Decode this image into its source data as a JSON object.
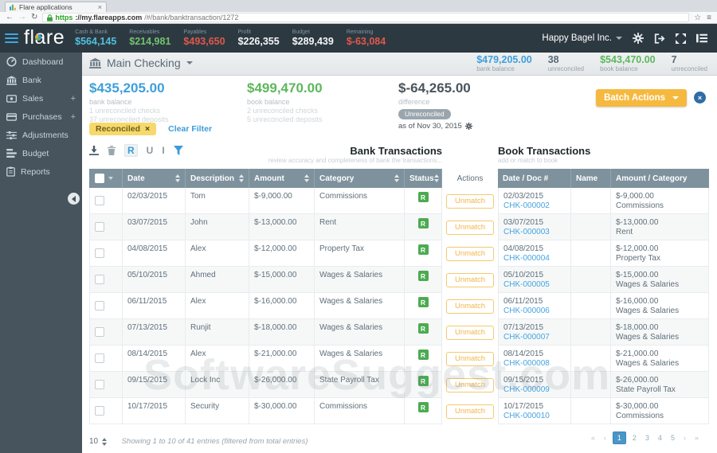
{
  "glyphs": {
    "close": "×",
    "plus": "+"
  },
  "browser": {
    "tab_title": "Flare applications",
    "nav": {
      "back": "←",
      "forward": "→",
      "refresh": "↻"
    },
    "url": {
      "protocol": "https",
      "host": "://my.flareapps.com",
      "path": "/#/bank/banktransaction/1272"
    },
    "actions": {
      "star": "☆",
      "menu": "≡"
    }
  },
  "topnav": {
    "logo": "flare",
    "stats": [
      {
        "label": "Cash & Bank",
        "value": "$564,145",
        "color": "#4fc0dd"
      },
      {
        "label": "Receivables",
        "value": "$214,981",
        "color": "#72c46d"
      },
      {
        "label": "Payables",
        "value": "$493,650",
        "color": "#e2574c"
      },
      {
        "label": "Profit",
        "value": "$226,355",
        "color": "#f4f6f7"
      },
      {
        "label": "Budget",
        "value": "$289,439",
        "color": "#f4f6f7"
      },
      {
        "label": "Remaining",
        "value": "$-63,084",
        "color": "#e2574c"
      }
    ],
    "company": "Happy Bagel Inc."
  },
  "sidebar": {
    "items": [
      {
        "label": "Dashboard",
        "expandable": false
      },
      {
        "label": "Bank",
        "expandable": false
      },
      {
        "label": "Sales",
        "expandable": true
      },
      {
        "label": "Purchases",
        "expandable": true
      },
      {
        "label": "Adjustments",
        "expandable": false
      },
      {
        "label": "Budget",
        "expandable": false
      },
      {
        "label": "Reports",
        "expandable": false
      }
    ]
  },
  "account_bar": {
    "account_name": "Main Checking",
    "bank_balance": {
      "value": "$479,205.00",
      "label": "bank balance"
    },
    "bank_unreconciled": {
      "value": "38",
      "label": "unreconciled"
    },
    "book_balance": {
      "value": "$543,470.00",
      "label": "book balance"
    },
    "book_unreconciled": {
      "value": "7",
      "label": "unreconciled"
    }
  },
  "summary": {
    "bank": {
      "value": "$435,205.00",
      "label": "bank balance",
      "line1": "1 unreconciled checks",
      "line2": "37 unreconciled deposits"
    },
    "book": {
      "value": "$499,470.00",
      "label": "book balance",
      "line1": "2 unreconciled checks",
      "line2": "5 unreconciled deposits"
    },
    "difference": {
      "value": "$-64,265.00",
      "label": "difference",
      "badge": "Unreconciled",
      "as_of": "as of Nov 30, 2015"
    },
    "batch_actions_label": "Batch Actions"
  },
  "filters": {
    "chip": "Reconciled",
    "clear_label": "Clear Filter"
  },
  "toolbar": {
    "r": "R",
    "u": "U",
    "i": "I"
  },
  "bank_table": {
    "title": "Bank Transactions",
    "subtitle": "review accuracy and completeness of bank the transactions...",
    "columns": [
      "Date",
      "Description",
      "Amount",
      "Category",
      "Status"
    ],
    "rows": [
      {
        "date": "02/03/2015",
        "description": "Tom",
        "amount": "$-9,000.00",
        "category": "Commissions",
        "status": "R"
      },
      {
        "date": "03/07/2015",
        "description": "John",
        "amount": "$-13,000.00",
        "category": "Rent",
        "status": "R"
      },
      {
        "date": "04/08/2015",
        "description": "Alex",
        "amount": "$-12,000.00",
        "category": "Property Tax",
        "status": "R"
      },
      {
        "date": "05/10/2015",
        "description": "Ahmed",
        "amount": "$-15,000.00",
        "category": "Wages & Salaries",
        "status": "R"
      },
      {
        "date": "06/11/2015",
        "description": "Alex",
        "amount": "$-16,000.00",
        "category": "Wages & Salaries",
        "status": "R"
      },
      {
        "date": "07/13/2015",
        "description": "Runjit",
        "amount": "$-18,000.00",
        "category": "Wages & Salaries",
        "status": "R"
      },
      {
        "date": "08/14/2015",
        "description": "Alex",
        "amount": "$-21,000.00",
        "category": "Wages & Salaries",
        "status": "R"
      },
      {
        "date": "09/15/2015",
        "description": "Lock Inc",
        "amount": "$-26,000.00",
        "category": "State Payroll Tax",
        "status": "R"
      },
      {
        "date": "10/17/2015",
        "description": "Security",
        "amount": "$-30,000.00",
        "category": "Commissions",
        "status": "R"
      }
    ]
  },
  "actions_column": {
    "header": "Actions",
    "button_label": "Unmatch"
  },
  "book_table": {
    "title": "Book Transactions",
    "subtitle": "add or match to book",
    "columns": [
      "Date / Doc #",
      "Name",
      "Amount / Category"
    ],
    "rows": [
      {
        "date": "02/03/2015",
        "doc": "CHK-000002",
        "name": "",
        "amount": "$-9,000.00",
        "category": "Commissions"
      },
      {
        "date": "03/07/2015",
        "doc": "CHK-000003",
        "name": "",
        "amount": "$-13,000.00",
        "category": "Rent"
      },
      {
        "date": "04/08/2015",
        "doc": "CHK-000004",
        "name": "",
        "amount": "$-12,000.00",
        "category": "Property Tax"
      },
      {
        "date": "05/10/2015",
        "doc": "CHK-000005",
        "name": "",
        "amount": "$-15,000.00",
        "category": "Wages & Salaries"
      },
      {
        "date": "06/11/2015",
        "doc": "CHK-000006",
        "name": "",
        "amount": "$-16,000.00",
        "category": "Wages & Salaries"
      },
      {
        "date": "07/13/2015",
        "doc": "CHK-000007",
        "name": "",
        "amount": "$-18,000.00",
        "category": "Wages & Salaries"
      },
      {
        "date": "08/14/2015",
        "doc": "CHK-000008",
        "name": "",
        "amount": "$-21,000.00",
        "category": "Wages & Salaries"
      },
      {
        "date": "09/15/2015",
        "doc": "CHK-000009",
        "name": "",
        "amount": "$-26,000.00",
        "category": "State Payroll Tax"
      },
      {
        "date": "10/17/2015",
        "doc": "CHK-000010",
        "name": "",
        "amount": "$-30,000.00",
        "category": "Commissions"
      }
    ]
  },
  "footer": {
    "page_size": "10",
    "showing": "Showing 1 to 10 of 41 entries (filtered from total entries)",
    "nav": {
      "first": "«",
      "prev": "‹",
      "next": "›",
      "last": "»"
    },
    "pages": [
      "1",
      "2",
      "3",
      "4",
      "5"
    ],
    "active_page": "1"
  },
  "watermark": "SoftwareSuggest.com"
}
